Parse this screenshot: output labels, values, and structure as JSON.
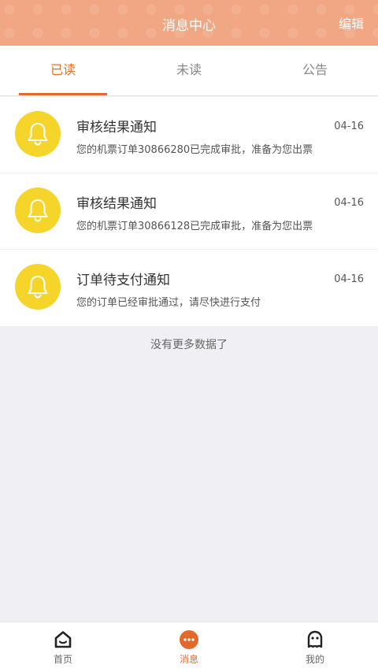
{
  "header": {
    "title": "消息中心",
    "edit_label": "编辑"
  },
  "tabs": [
    {
      "label": "已读",
      "active": true
    },
    {
      "label": "未读",
      "active": false
    },
    {
      "label": "公告",
      "active": false
    }
  ],
  "messages": [
    {
      "icon": "bell-icon",
      "title": "审核结果通知",
      "date": "04-16",
      "body": "您的机票订单30866280已完成审批，准备为您出票"
    },
    {
      "icon": "bell-icon",
      "title": "审核结果通知",
      "date": "04-16",
      "body": "您的机票订单30866128已完成审批，准备为您出票"
    },
    {
      "icon": "bell-icon",
      "title": "订单待支付通知",
      "date": "04-16",
      "body": "您的订单已经审批通过，请尽快进行支付"
    }
  ],
  "no_more_text": "没有更多数据了",
  "bottom_nav": [
    {
      "icon": "home-icon",
      "label": "首页",
      "active": false
    },
    {
      "icon": "message-icon",
      "label": "消息",
      "active": true
    },
    {
      "icon": "profile-icon",
      "label": "我的",
      "active": false
    }
  ],
  "colors": {
    "header_bg": "#f2a784",
    "accent": "#e3692a",
    "bell_bg": "#f5d52a"
  }
}
